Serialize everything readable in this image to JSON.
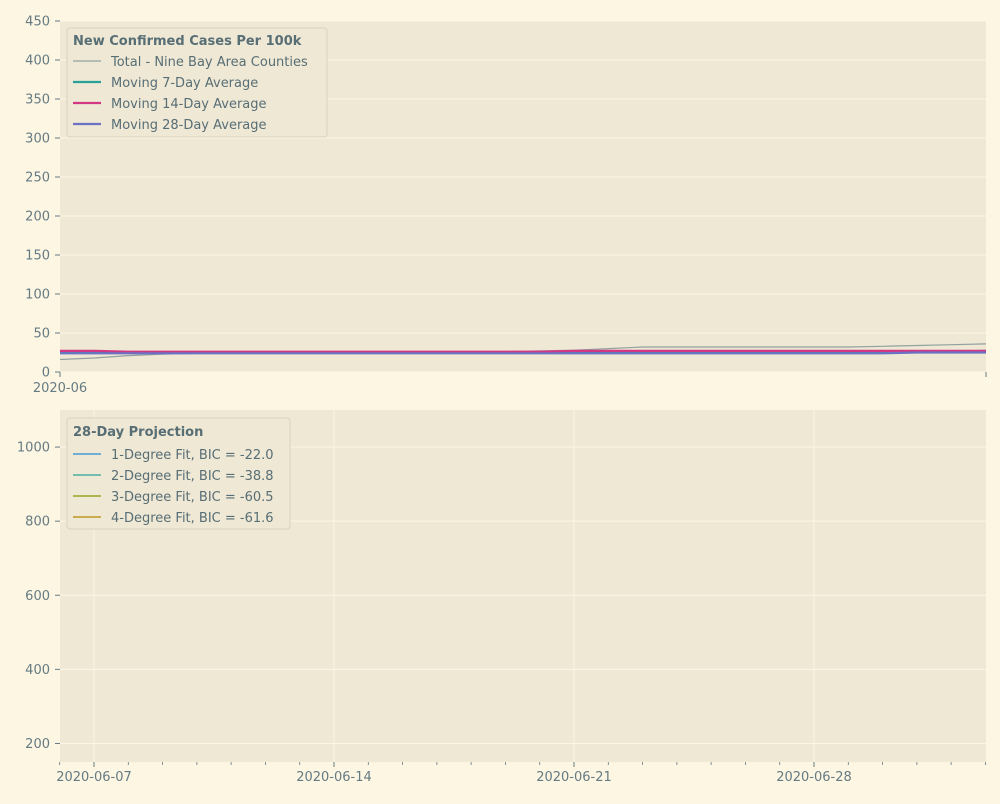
{
  "colors": {
    "figure_bg": "#fdf6e3",
    "axes_bg": "#eee8d5",
    "grid": "#fdf6e3",
    "tick_text": "#657b83",
    "legend_text": "#586e75"
  },
  "chart_data": [
    {
      "type": "line",
      "legend": {
        "title": "New Confirmed Cases Per 100k",
        "placement": "top-left"
      },
      "x_ticks": [
        "2020-06"
      ],
      "ylim": [
        0,
        450
      ],
      "y_ticks": [
        "0",
        "50",
        "100",
        "150",
        "200",
        "250",
        "300",
        "350",
        "400",
        "450"
      ],
      "grid": true,
      "x": [
        "2020-06-06",
        "2020-06-07",
        "2020-06-08",
        "2020-06-09",
        "2020-06-10",
        "2020-06-11",
        "2020-06-12",
        "2020-06-13",
        "2020-06-14",
        "2020-06-15",
        "2020-06-16",
        "2020-06-17",
        "2020-06-18",
        "2020-06-19",
        "2020-06-20",
        "2020-06-21",
        "2020-06-22",
        "2020-06-23",
        "2020-06-24",
        "2020-06-25",
        "2020-06-26",
        "2020-06-27",
        "2020-06-28",
        "2020-06-29",
        "2020-06-30",
        "2020-07-01",
        "2020-07-02",
        "2020-07-03"
      ],
      "series": [
        {
          "name": "Total - Nine Bay Area Counties",
          "color": "#93a1a1",
          "width": 1.2,
          "values": [
            16,
            18,
            21,
            23,
            24,
            25,
            26,
            26,
            26,
            26,
            26,
            26,
            26,
            26,
            27,
            28,
            30,
            32,
            32,
            32,
            32,
            32,
            32,
            32,
            33,
            34,
            35,
            36
          ]
        },
        {
          "name": "Moving 7-Day Average",
          "color": "#2aa198",
          "width": 2.2,
          "values": [
            25,
            25,
            25,
            25,
            25,
            25,
            25,
            25,
            25,
            25,
            25,
            25,
            25,
            25,
            25,
            25,
            25,
            26,
            26,
            26,
            26,
            26,
            26,
            26,
            26,
            26,
            26,
            27
          ]
        },
        {
          "name": "Moving 14-Day Average",
          "color": "#d33682",
          "width": 2.2,
          "values": [
            27,
            27,
            26,
            26,
            26,
            26,
            26,
            26,
            26,
            26,
            26,
            26,
            26,
            26,
            26,
            27,
            27,
            27,
            27,
            27,
            27,
            27,
            27,
            27,
            27,
            27,
            27,
            27
          ]
        },
        {
          "name": "Moving 28-Day Average",
          "color": "#6c71c4",
          "width": 2.2,
          "values": [
            24,
            24,
            24,
            24,
            24,
            24,
            24,
            24,
            24,
            24,
            24,
            24,
            24,
            24,
            24,
            24,
            24,
            24,
            24,
            24,
            24,
            24,
            24,
            24,
            24,
            25,
            25,
            25
          ]
        }
      ]
    },
    {
      "type": "line",
      "legend": {
        "title": "28-Day Projection",
        "placement": "top-left"
      },
      "x_ticks": [
        "2020-06-07",
        "2020-06-14",
        "2020-06-21",
        "2020-06-28"
      ],
      "ylim": [
        150,
        1100
      ],
      "y_ticks": [
        "200",
        "400",
        "600",
        "800",
        "1000"
      ],
      "grid": true,
      "series": [
        {
          "name": "1-Degree Fit, BIC = -22.0",
          "color": "#268bd2",
          "values": []
        },
        {
          "name": "2-Degree Fit, BIC = -38.8",
          "color": "#2aa198",
          "values": []
        },
        {
          "name": "3-Degree Fit, BIC = -60.5",
          "color": "#859900",
          "values": []
        },
        {
          "name": "4-Degree Fit, BIC = -61.6",
          "color": "#b58900",
          "values": []
        }
      ]
    }
  ]
}
